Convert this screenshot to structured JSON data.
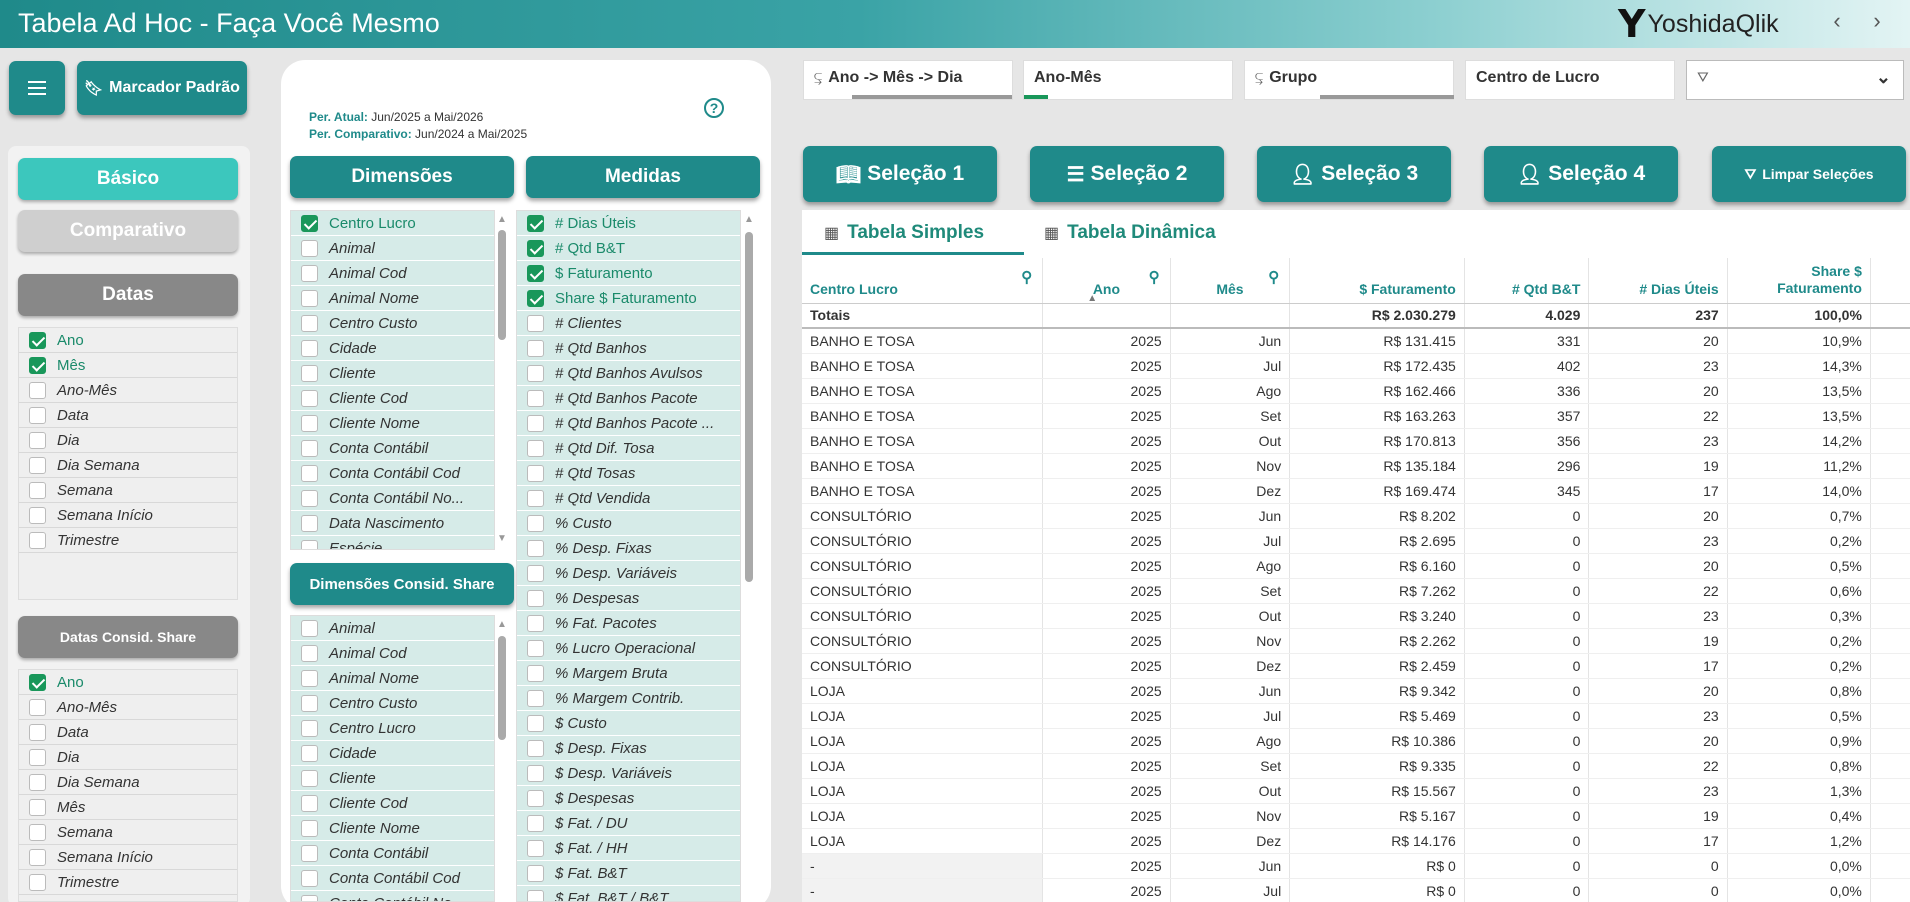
{
  "header": {
    "title": "Tabela Ad Hoc - Faça Você Mesmo",
    "logo_mark": "Y",
    "brand": "YoshidaQlik",
    "nav_prev": "‹",
    "nav_next": "›"
  },
  "toolbar": {
    "bookmark_label": "Marcador Padrão"
  },
  "left": {
    "basico": "Básico",
    "comparativo": "Comparativo",
    "datas": "Datas",
    "datas_items": [
      {
        "label": "Ano",
        "checked": true
      },
      {
        "label": "Mês",
        "checked": true
      },
      {
        "label": "Ano-Mês",
        "checked": false
      },
      {
        "label": "Data",
        "checked": false
      },
      {
        "label": "Dia",
        "checked": false
      },
      {
        "label": "Dia Semana",
        "checked": false
      },
      {
        "label": "Semana",
        "checked": false
      },
      {
        "label": "Semana Início",
        "checked": false
      },
      {
        "label": "Trimestre",
        "checked": false
      }
    ],
    "share_title": "Datas Consid. Share",
    "share_items": [
      {
        "label": "Ano",
        "checked": true
      },
      {
        "label": "Ano-Mês",
        "checked": false
      },
      {
        "label": "Data",
        "checked": false
      },
      {
        "label": "Dia",
        "checked": false
      },
      {
        "label": "Dia Semana",
        "checked": false
      },
      {
        "label": "Mês",
        "checked": false
      },
      {
        "label": "Semana",
        "checked": false
      },
      {
        "label": "Semana Início",
        "checked": false
      },
      {
        "label": "Trimestre",
        "checked": false
      }
    ]
  },
  "period": {
    "atual_label": "Per. Atual:",
    "atual_value": "Jun/2025 a Mai/2026",
    "comp_label": "Per. Comparativo:",
    "comp_value": "Jun/2024 a Mai/2025",
    "help": "?"
  },
  "dimensoes": {
    "title": "Dimensões",
    "items": [
      {
        "label": "Centro Lucro",
        "checked": true
      },
      {
        "label": "Animal",
        "checked": false
      },
      {
        "label": "Animal Cod",
        "checked": false
      },
      {
        "label": "Animal Nome",
        "checked": false
      },
      {
        "label": "Centro Custo",
        "checked": false
      },
      {
        "label": "Cidade",
        "checked": false
      },
      {
        "label": "Cliente",
        "checked": false
      },
      {
        "label": "Cliente Cod",
        "checked": false
      },
      {
        "label": "Cliente Nome",
        "checked": false
      },
      {
        "label": "Conta Contábil",
        "checked": false
      },
      {
        "label": "Conta Contábil Cod",
        "checked": false
      },
      {
        "label": "Conta Contábil No...",
        "checked": false
      },
      {
        "label": "Data Nascimento",
        "checked": false
      },
      {
        "label": "Espécie",
        "checked": false
      }
    ]
  },
  "dim_share": {
    "title": "Dimensões Consid. Share",
    "items": [
      {
        "label": "Animal",
        "checked": false
      },
      {
        "label": "Animal Cod",
        "checked": false
      },
      {
        "label": "Animal Nome",
        "checked": false
      },
      {
        "label": "Centro Custo",
        "checked": false
      },
      {
        "label": "Centro Lucro",
        "checked": false
      },
      {
        "label": "Cidade",
        "checked": false
      },
      {
        "label": "Cliente",
        "checked": false
      },
      {
        "label": "Cliente Cod",
        "checked": false
      },
      {
        "label": "Cliente Nome",
        "checked": false
      },
      {
        "label": "Conta Contábil",
        "checked": false
      },
      {
        "label": "Conta Contábil Cod",
        "checked": false
      },
      {
        "label": "Conta Contábil No...",
        "checked": false
      }
    ]
  },
  "medidas": {
    "title": "Medidas",
    "items": [
      {
        "label": "# Dias Úteis",
        "checked": true
      },
      {
        "label": "# Qtd B&T",
        "checked": true
      },
      {
        "label": "$ Faturamento",
        "checked": true
      },
      {
        "label": "Share $ Faturamento",
        "checked": true
      },
      {
        "label": "# Clientes",
        "checked": false
      },
      {
        "label": "# Qtd Banhos",
        "checked": false
      },
      {
        "label": "# Qtd Banhos Avulsos",
        "checked": false
      },
      {
        "label": "# Qtd Banhos Pacote",
        "checked": false
      },
      {
        "label": "# Qtd Banhos Pacote ...",
        "checked": false
      },
      {
        "label": "# Qtd Dif. Tosa",
        "checked": false
      },
      {
        "label": "# Qtd Tosas",
        "checked": false
      },
      {
        "label": "# Qtd Vendida",
        "checked": false
      },
      {
        "label": "% Custo",
        "checked": false
      },
      {
        "label": "% Desp. Fixas",
        "checked": false
      },
      {
        "label": "% Desp. Variáveis",
        "checked": false
      },
      {
        "label": "% Despesas",
        "checked": false
      },
      {
        "label": "% Fat. Pacotes",
        "checked": false
      },
      {
        "label": "% Lucro Operacional",
        "checked": false
      },
      {
        "label": "% Margem Bruta",
        "checked": false
      },
      {
        "label": "% Margem Contrib.",
        "checked": false
      },
      {
        "label": "$ Custo",
        "checked": false
      },
      {
        "label": "$ Desp. Fixas",
        "checked": false
      },
      {
        "label": "$ Desp. Variáveis",
        "checked": false
      },
      {
        "label": "$ Despesas",
        "checked": false
      },
      {
        "label": "$ Fat. / DU",
        "checked": false
      },
      {
        "label": "$ Fat. / HH",
        "checked": false
      },
      {
        "label": "$ Fat. B&T",
        "checked": false
      },
      {
        "label": "$ Fat. B&T / B&T",
        "checked": false
      }
    ]
  },
  "filters": {
    "f1": "Ano -> Mês -> Dia",
    "f2": "Ano-Mês",
    "f3": "Grupo",
    "f4": "Centro de Lucro",
    "f5": ""
  },
  "selections": {
    "s1": "Seleção 1",
    "s2": "Seleção 2",
    "s3": "Seleção 3",
    "s4": "Seleção 4",
    "clear": "Limpar Seleções"
  },
  "tabs": {
    "simple": "Tabela Simples",
    "pivot": "Tabela Dinâmica"
  },
  "table": {
    "headers": [
      "Centro Lucro",
      "Ano",
      "Mês",
      "$ Faturamento",
      "# Qtd B&T",
      "# Dias Úteis",
      "Share $ Faturamento"
    ],
    "totals": [
      "Totais",
      "",
      "",
      "R$ 2.030.279",
      "4.029",
      "237",
      "100,0%"
    ],
    "rows": [
      [
        "BANHO E TOSA",
        "2025",
        "Jun",
        "R$ 131.415",
        "331",
        "20",
        "10,9%"
      ],
      [
        "BANHO E TOSA",
        "2025",
        "Jul",
        "R$ 172.435",
        "402",
        "23",
        "14,3%"
      ],
      [
        "BANHO E TOSA",
        "2025",
        "Ago",
        "R$ 162.466",
        "336",
        "20",
        "13,5%"
      ],
      [
        "BANHO E TOSA",
        "2025",
        "Set",
        "R$ 163.263",
        "357",
        "22",
        "13,5%"
      ],
      [
        "BANHO E TOSA",
        "2025",
        "Out",
        "R$ 170.813",
        "356",
        "23",
        "14,2%"
      ],
      [
        "BANHO E TOSA",
        "2025",
        "Nov",
        "R$ 135.184",
        "296",
        "19",
        "11,2%"
      ],
      [
        "BANHO E TOSA",
        "2025",
        "Dez",
        "R$ 169.474",
        "345",
        "17",
        "14,0%"
      ],
      [
        "CONSULTÓRIO",
        "2025",
        "Jun",
        "R$ 8.202",
        "0",
        "20",
        "0,7%"
      ],
      [
        "CONSULTÓRIO",
        "2025",
        "Jul",
        "R$ 2.695",
        "0",
        "23",
        "0,2%"
      ],
      [
        "CONSULTÓRIO",
        "2025",
        "Ago",
        "R$ 6.160",
        "0",
        "20",
        "0,5%"
      ],
      [
        "CONSULTÓRIO",
        "2025",
        "Set",
        "R$ 7.262",
        "0",
        "22",
        "0,6%"
      ],
      [
        "CONSULTÓRIO",
        "2025",
        "Out",
        "R$ 3.240",
        "0",
        "23",
        "0,3%"
      ],
      [
        "CONSULTÓRIO",
        "2025",
        "Nov",
        "R$ 2.262",
        "0",
        "19",
        "0,2%"
      ],
      [
        "CONSULTÓRIO",
        "2025",
        "Dez",
        "R$ 2.459",
        "0",
        "17",
        "0,2%"
      ],
      [
        "LOJA",
        "2025",
        "Jun",
        "R$ 9.342",
        "0",
        "20",
        "0,8%"
      ],
      [
        "LOJA",
        "2025",
        "Jul",
        "R$ 5.469",
        "0",
        "23",
        "0,5%"
      ],
      [
        "LOJA",
        "2025",
        "Ago",
        "R$ 10.386",
        "0",
        "20",
        "0,9%"
      ],
      [
        "LOJA",
        "2025",
        "Set",
        "R$ 9.335",
        "0",
        "22",
        "0,8%"
      ],
      [
        "LOJA",
        "2025",
        "Out",
        "R$ 15.567",
        "0",
        "23",
        "1,3%"
      ],
      [
        "LOJA",
        "2025",
        "Nov",
        "R$ 5.167",
        "0",
        "19",
        "0,4%"
      ],
      [
        "LOJA",
        "2025",
        "Dez",
        "R$ 14.176",
        "0",
        "17",
        "1,2%"
      ],
      [
        "-",
        "2025",
        "Jun",
        "R$ 0",
        "0",
        "0",
        "0,0%"
      ],
      [
        "-",
        "2025",
        "Jul",
        "R$ 0",
        "0",
        "0",
        "0,0%"
      ]
    ]
  },
  "colors": {
    "teal": "#1f8a8a",
    "light_teal": "#3cc7bd",
    "check_green": "#19975a",
    "gray_pill": "#888888"
  }
}
